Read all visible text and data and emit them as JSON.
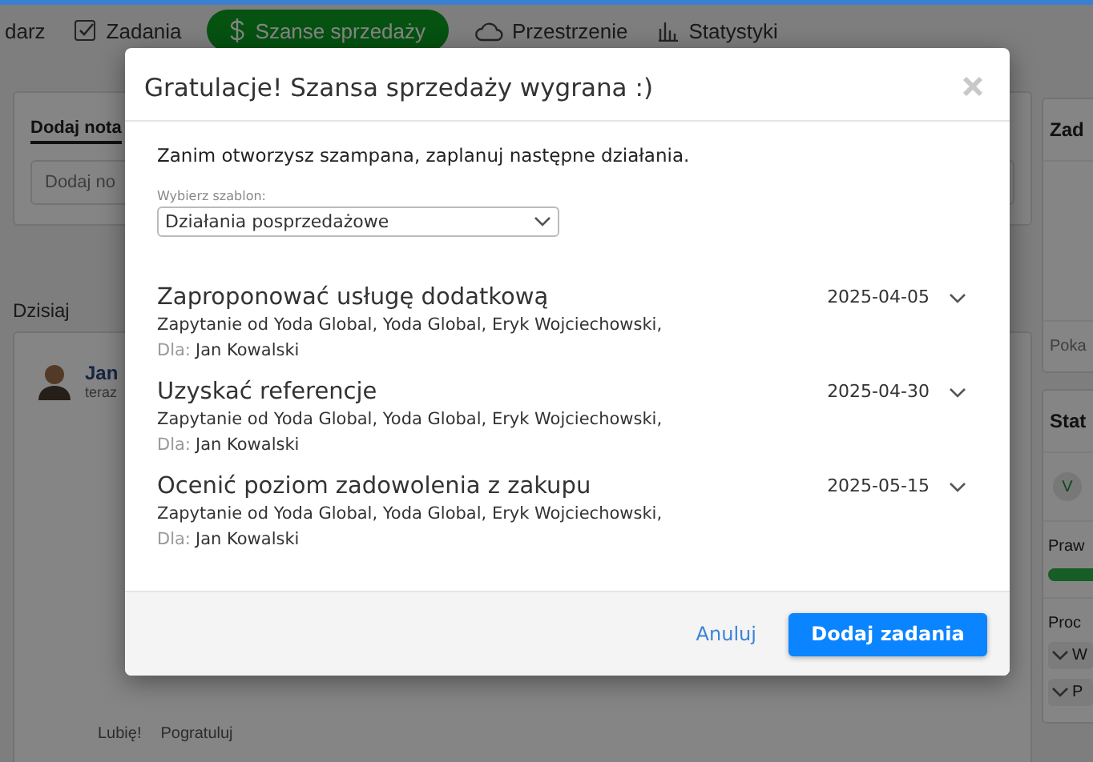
{
  "nav": {
    "items": [
      {
        "label": "darz",
        "selected": false
      },
      {
        "label": "Zadania",
        "selected": false
      },
      {
        "label": "Szanse sprzedaży",
        "selected": true
      },
      {
        "label": "Przestrzenie",
        "selected": false
      },
      {
        "label": "Statystyki",
        "selected": false
      }
    ]
  },
  "left": {
    "note_tab": "Dodaj nota",
    "note_placeholder": "Dodaj no",
    "day": "Dzisiaj",
    "post": {
      "author": "Jan",
      "time": "teraz",
      "actions": [
        "Lubię!",
        "Pogratuluj"
      ]
    }
  },
  "right": {
    "tasks_title": "Zad",
    "tasks_link": "Poka",
    "status_title": "Stat",
    "status_badge": "V",
    "progress": {
      "label": "Praw",
      "level": 1
    },
    "process_label": "Proc",
    "process_items": [
      "W",
      "P"
    ]
  },
  "modal": {
    "title": "Gratulacje! Szansa sprzedaży wygrana :)",
    "intro": "Zanim otworzysz szampana, zaplanuj następne działania.",
    "template_label": "Wybierz szablon:",
    "template_value": "Działania posprzedażowe",
    "tasks": [
      {
        "title": "Zaproponować usługę dodatkową",
        "date": "2025-04-05",
        "context": "Zapytanie od Yoda Global, Yoda Global, Eryk Wojciechowski,",
        "for_label": "Dla:",
        "for": "Jan Kowalski"
      },
      {
        "title": "Uzyskać referencje",
        "date": "2025-04-30",
        "context": "Zapytanie od Yoda Global, Yoda Global, Eryk Wojciechowski,",
        "for_label": "Dla:",
        "for": "Jan Kowalski"
      },
      {
        "title": "Ocenić poziom zadowolenia z zakupu",
        "date": "2025-05-15",
        "context": "Zapytanie od Yoda Global, Yoda Global, Eryk Wojciechowski,",
        "for_label": "Dla:",
        "for": "Jan Kowalski"
      }
    ],
    "cancel": "Anuluj",
    "submit": "Dodaj zadania"
  }
}
